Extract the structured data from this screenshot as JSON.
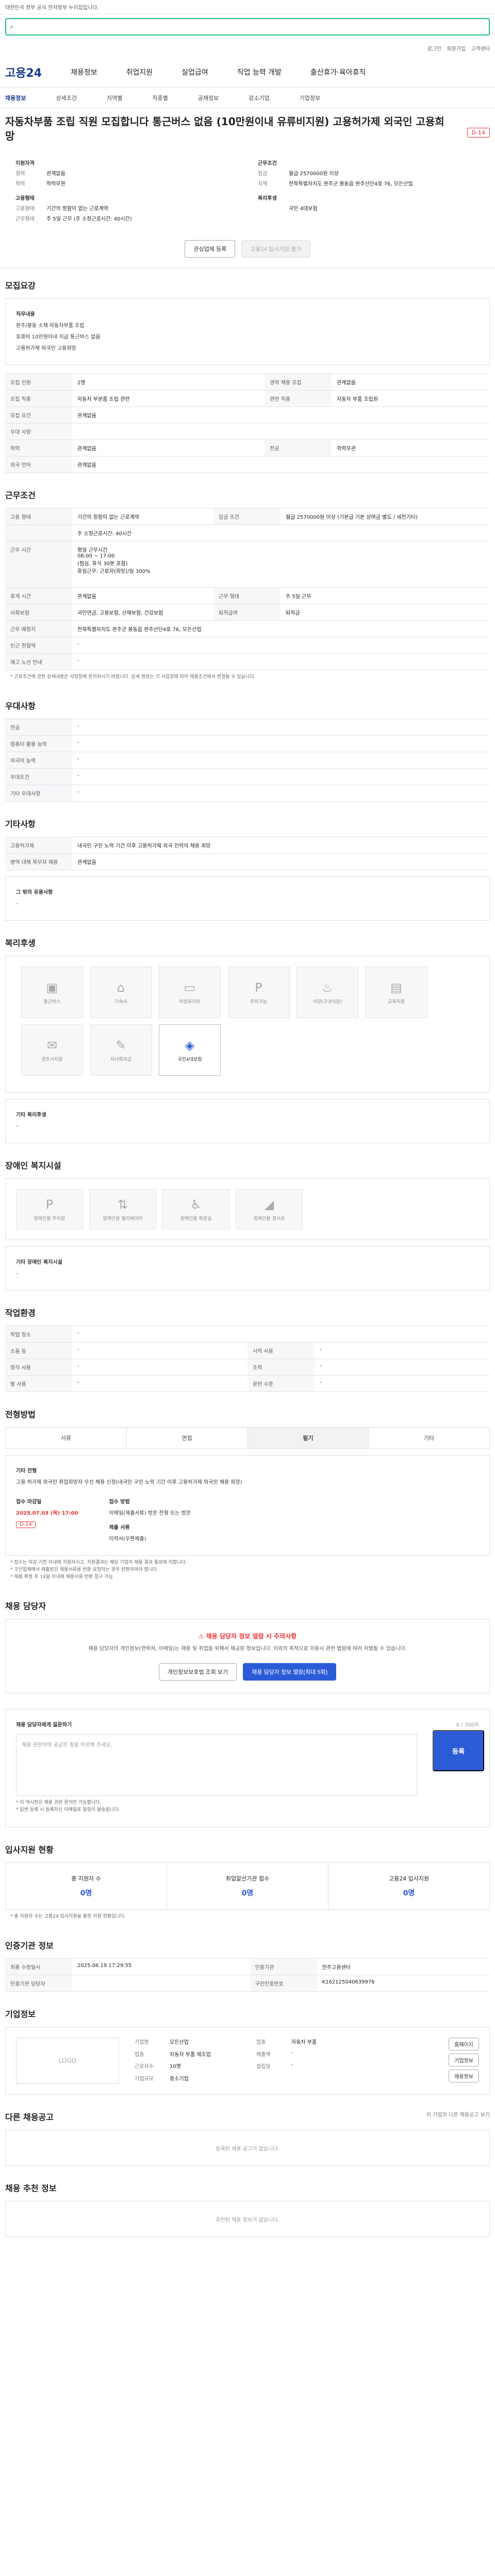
{
  "topbar": {
    "notice": "대한민국 정부 공식 전자정부 누리집입니다."
  },
  "search": {
    "placeholder": ""
  },
  "util": {
    "items": [
      "로그인",
      "회원가입",
      "고객센터"
    ]
  },
  "brand": {
    "logo": "고용24"
  },
  "gnb": {
    "items": [
      "채용정보",
      "취업지원",
      "실업급여",
      "직업 능력 개발",
      "출산휴가·육아휴직"
    ]
  },
  "subnav": {
    "items": [
      "채용정보",
      "상세조건",
      "지역별",
      "직종별",
      "공채정보",
      "강소기업",
      "기업정보"
    ]
  },
  "job": {
    "title": "자동차부품 조립 직원 모집합니다 통근버스 없음 (10만원이내 유류비지원) 고용허가제 외국인 고용희망",
    "dday": "D-14"
  },
  "summary": {
    "left_h": "지원자격",
    "left": [
      [
        "경력",
        "관계없음"
      ],
      [
        "학력",
        "학력무관"
      ]
    ],
    "left2_h": "고용형태",
    "left2": [
      [
        "고용형태",
        "기간의 정함이 없는 근로계약"
      ],
      [
        "근무형태",
        "주 5일 근무 (주 소정근로시간: 40시간)"
      ]
    ],
    "right_h": "근무조건",
    "right": [
      [
        "임금",
        "월급 2570000원 이상"
      ],
      [
        "지역",
        "전북특별자치도 완주군 봉동읍 완주산단4로 76, 모든산업"
      ]
    ],
    "right2_h": "복리후생",
    "right2": [
      [
        "",
        "국민 4대보험"
      ]
    ]
  },
  "actions": {
    "save": "관심업체 등록",
    "apply": "고용24 입사지원 불가"
  },
  "qual": {
    "title": "모집요강",
    "items": [
      "직무내용",
      "완주/봉동 소재 자동차부품 조립",
      "유류비 10만원이내 지급 통근버스 없음",
      "고용허가제 외국인 고용희망"
    ],
    "rows": [
      [
        "모집 인원",
        "2명",
        "경력 채용 모집",
        "관계없음"
      ],
      [
        "모집 직종",
        "자동차 부분품 조립 관련",
        "관련 직종",
        "자동차 부품 조립원"
      ],
      [
        "모집 요건",
        "관계없음",
        "",
        ""
      ],
      [
        "우대 사항",
        "",
        "",
        ""
      ],
      [
        "학력",
        "관계없음",
        "전공",
        "학력무관"
      ],
      [
        "외국 언어",
        "관계없음",
        "",
        ""
      ]
    ]
  },
  "cond": {
    "title": "근무조건",
    "rows": [
      [
        "고용 형태",
        "기간의 정함이 없는 근로계약",
        "임금 조건",
        "월급 2570000원 이상 (기본급 기본 상여금 별도 / 세전기타)"
      ],
      [
        "",
        "주 소정근로시간: 40시간",
        "",
        ""
      ],
      [
        "근무 시간",
        "평일 근무시간\n08:00 ~ 17:00\n(점심, 휴식 30분 포함)\n휴일근무: 근로자(희망)/일 300%",
        "",
        ""
      ],
      [
        "휴게 시간",
        "관계없음",
        "근무 형태",
        "주 5일 근무"
      ],
      [
        "사회보험",
        "국민연금, 고용보험, 산재보험, 건강보험",
        "퇴직급여",
        "퇴직금"
      ],
      [
        "근무 예정지",
        "전북특별자치도 완주군 봉동읍 완주산단4로 76, 모든산업",
        "",
        ""
      ],
      [
        "인근 전철역",
        "-",
        "",
        ""
      ],
      [
        "재고 노선 안내",
        "-",
        "",
        ""
      ]
    ],
    "note": "* 근로조건에 관한 상세내용은 사업장에 문의하시기 바랍니다. 상세 정보는 각 사업장에 따라 채용조건에서 변경될 수 있습니다."
  },
  "pref": {
    "title": "우대사항",
    "rows": [
      [
        "전공",
        "-"
      ],
      [
        "컴퓨터 활용 능력",
        "-"
      ],
      [
        "외국어 능력",
        "-"
      ],
      [
        "우대조건",
        "-"
      ],
      [
        "기타 우대사항",
        "-"
      ]
    ]
  },
  "etc": {
    "title": "기타사항",
    "rows": [
      [
        "고용허가제",
        "내국인 구인 노력 기간 이후 고용허가제 외국 인력의 채용 희망"
      ],
      [
        "병역 대체 복무자 채용",
        "관계없음"
      ]
    ],
    "extra_h": "그 밖의 유용사항",
    "extra": "-"
  },
  "welfare": {
    "title": "복리후생",
    "items": [
      "통근버스",
      "기숙사",
      "차량유지비",
      "주차가능",
      "식당(구내식당)",
      "교육지원",
      "경조사지원",
      "자녀학자금",
      "국민4대보험"
    ],
    "other_h": "기타 복리후생",
    "other": "-"
  },
  "disab": {
    "title": "장애인 복지시설",
    "items": [
      "장애인용 주차장",
      "장애인용 엘리베이터",
      "장애인용 화장실",
      "장애인용 경사로"
    ],
    "other_h": "기타 장애인 복지시설",
    "other": "-"
  },
  "env": {
    "title": "작업환경",
    "rows": [
      [
        "작업 장소",
        "-",
        "",
        ""
      ],
      [
        "소음 등",
        "-",
        "시력 사용",
        "-"
      ],
      [
        "청각 사용",
        "-",
        "조작",
        "-"
      ],
      [
        "팔 사용",
        "-",
        "운반 수준",
        "-"
      ]
    ]
  },
  "process": {
    "title": "전형방법",
    "tabs": [
      "서류",
      "면접",
      "필기",
      "기타"
    ],
    "desc_h": "기타 전형",
    "desc": "고용 허가제 외국인 취업희망자 우선 채용 신청(내국인 구인 노력 기간 이후 고용허가제 외국인 채용 희망)",
    "deadline_h": "접수 마감일",
    "deadline": "2025.07.03 (목) 17:00",
    "deadline_badge": "D-14",
    "method_h": "접수 방법",
    "method": "이메일(제출서류) 방문 전형 또는 방문",
    "docs_h": "제출 서류",
    "docs": "이력서(우편제출)",
    "notes": [
      "* 접수는 마감 기한 이내에 지원하시고, 지원결과는 해당 기업의 채용 결과 통보에 의합니다.",
      "* 구인업체에서 제출받은 채용서류를 반환 요청하는 경우 반환하여야 합니다.",
      "* 채용 확정 후 14일 이내에 채용서류 반환 청구 가능"
    ]
  },
  "contact": {
    "title": "채용 담당자",
    "alert_t": "채용 담당자 정보 열람 시 주의사항",
    "alert_d": "채용 담당자의 개인정보(연락처, 이메일)는 채용 및 취업을 위해서 제공된 정보입니다. 이외의 목적으로 이용시 관련 법령에 따라 처벌될 수 있습니다.",
    "b1": "개인정보보호법 조회 보기",
    "b2": "채용 담당자 정보 열람(최대 5회)"
  },
  "ask": {
    "title": "채용 담당자에게 질문하기",
    "placeholder": "채용 관련하여 궁금한 점을 작성해 주세요.",
    "register": "등록",
    "count": "0 / 300자",
    "notes": [
      "* 이 게시판은 채용 관련 문의만 가능합니다.",
      "* 답변 등록 시 등록하신 이메일로 알림이 발송됩니다."
    ]
  },
  "status": {
    "title": "입사지원 현황",
    "items": [
      [
        "총 지원자 수",
        "0명"
      ],
      [
        "취업알선기관 접수",
        "0명"
      ],
      [
        "고용24 입사지원",
        "0명"
      ]
    ],
    "note": "* 총 지원자 수는 고용24 입사지원을 통한 지원 현황입니다."
  },
  "info": {
    "title": "인증기관 정보",
    "rows": [
      [
        "최종 수정일시",
        "2025.06.19 17:29:55",
        "인증기관",
        "전주고용센터"
      ],
      [
        "인증기관 담당자",
        "",
        "구인인증번호",
        "K162125040639976"
      ]
    ]
  },
  "company": {
    "title": "기업정보",
    "logo": "LOGO",
    "fields": [
      [
        "기업명",
        "모든산업",
        "업종",
        "자동차 부품"
      ],
      [
        "업종",
        "자동차 부품 제조업",
        "매출액",
        "-"
      ],
      [
        "근로자수",
        "10명",
        "설립일",
        "-"
      ],
      [
        "기업규모",
        "중소기업",
        "",
        ""
      ]
    ],
    "buttons": [
      "홈페이지",
      "기업정보",
      "채용정보"
    ]
  },
  "same": {
    "title": "다른 채용공고",
    "hdr": "이 기업의 다른 채용공고 보기",
    "empty": "등록된 채용 공고가 없습니다."
  },
  "recommend": {
    "title": "채용 추천 정보",
    "empty": "추천된 채용 정보가 없습니다."
  }
}
